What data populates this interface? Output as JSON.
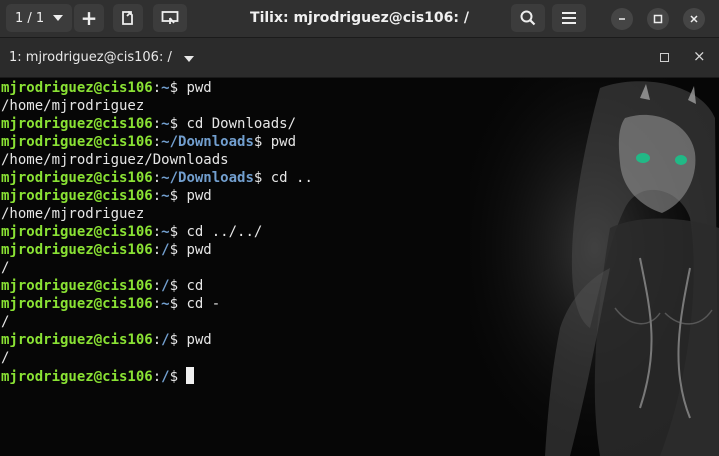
{
  "header": {
    "session_label": "1 / 1",
    "add_label": "+",
    "title": "Tilix: mjrodriguez@cis106: /"
  },
  "terminal_bar": {
    "title": "1: mjrodriguez@cis106: /"
  },
  "icons": {
    "session": "chevron-down-icon",
    "add": "plus-icon",
    "new_window": "new-window-icon",
    "sync": "sync-input-icon",
    "search": "search-icon",
    "menu": "hamburger-menu-icon",
    "minimize": "minimize-icon",
    "maximize": "maximize-icon",
    "close": "close-icon"
  },
  "colors": {
    "prompt_user": "#8ae234",
    "prompt_path": "#729fcf",
    "text": "#e6e6e6",
    "background": "#060606"
  },
  "terminal": {
    "lines": [
      {
        "user": "mjrodriguez@cis106",
        "sep": ":",
        "path": "~",
        "dollar": "$ ",
        "cmd": "pwd"
      },
      {
        "output": "/home/mjrodriguez"
      },
      {
        "user": "mjrodriguez@cis106",
        "sep": ":",
        "path": "~",
        "dollar": "$ ",
        "cmd": "cd Downloads/"
      },
      {
        "user": "mjrodriguez@cis106",
        "sep": ":",
        "path": "~/Downloads",
        "dollar": "$ ",
        "cmd": "pwd"
      },
      {
        "output": "/home/mjrodriguez/Downloads"
      },
      {
        "user": "mjrodriguez@cis106",
        "sep": ":",
        "path": "~/Downloads",
        "dollar": "$ ",
        "cmd": "cd .."
      },
      {
        "user": "mjrodriguez@cis106",
        "sep": ":",
        "path": "~",
        "dollar": "$ ",
        "cmd": "pwd"
      },
      {
        "output": "/home/mjrodriguez"
      },
      {
        "user": "mjrodriguez@cis106",
        "sep": ":",
        "path": "~",
        "dollar": "$ ",
        "cmd": "cd ../../"
      },
      {
        "user": "mjrodriguez@cis106",
        "sep": ":",
        "path": "/",
        "dollar": "$ ",
        "cmd": "pwd"
      },
      {
        "output": "/"
      },
      {
        "user": "mjrodriguez@cis106",
        "sep": ":",
        "path": "/",
        "dollar": "$ ",
        "cmd": "cd"
      },
      {
        "user": "mjrodriguez@cis106",
        "sep": ":",
        "path": "~",
        "dollar": "$ ",
        "cmd": "cd -"
      },
      {
        "output": "/"
      },
      {
        "user": "mjrodriguez@cis106",
        "sep": ":",
        "path": "/",
        "dollar": "$ ",
        "cmd": "pwd"
      },
      {
        "output": "/"
      },
      {
        "user": "mjrodriguez@cis106",
        "sep": ":",
        "path": "/",
        "dollar": "$ ",
        "cmd": "",
        "cursor": true
      }
    ]
  }
}
